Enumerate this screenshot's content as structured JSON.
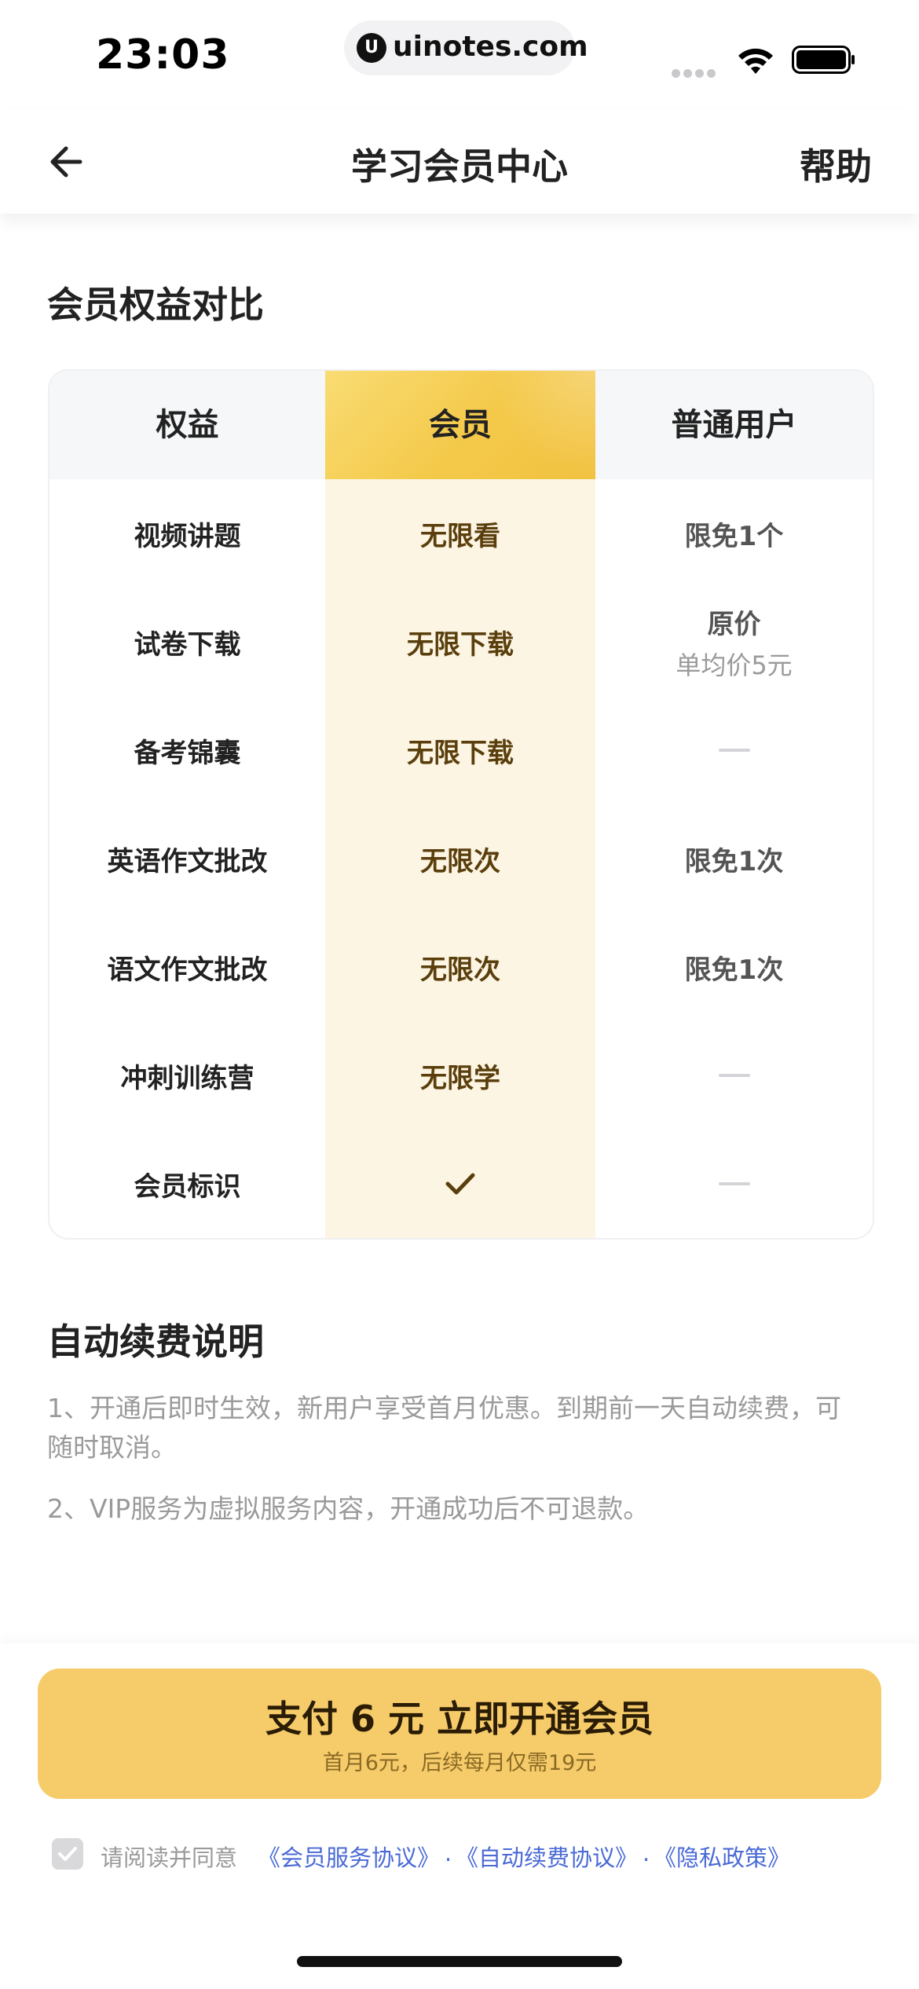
{
  "status_bar": {
    "time": "23:03",
    "url": "uinotes.com",
    "icons": [
      "signal-icon",
      "wifi-icon",
      "battery-icon"
    ]
  },
  "nav": {
    "title": "学习会员中心",
    "help": "帮助",
    "back_icon": "back-arrow-icon"
  },
  "benefits": {
    "title": "会员权益对比",
    "headers": [
      "权益",
      "会员",
      "普通用户"
    ],
    "rows": [
      {
        "benefit": "视频讲题",
        "member": "无限看",
        "normal": "限免1个",
        "normal_sub": ""
      },
      {
        "benefit": "试卷下载",
        "member": "无限下载",
        "normal": "原价",
        "normal_sub": "单均价5元"
      },
      {
        "benefit": "备考锦囊",
        "member": "无限下载",
        "normal": "",
        "normal_sub": ""
      },
      {
        "benefit": "英语作文批改",
        "member": "无限次",
        "normal": "限免1次",
        "normal_sub": ""
      },
      {
        "benefit": "语文作文批改",
        "member": "无限次",
        "normal": "限免1次",
        "normal_sub": ""
      },
      {
        "benefit": "冲刺训练营",
        "member": "无限学",
        "normal": "",
        "normal_sub": ""
      },
      {
        "benefit": "会员标识",
        "member": "",
        "normal": "",
        "normal_sub": ""
      }
    ]
  },
  "renewal": {
    "title": "自动续费说明",
    "notes": [
      "1、开通后即时生效，新用户享受首月优惠。到期前一天自动续费，可随时取消。",
      "2、VIP服务为虚拟服务内容，开通成功后不可退款。"
    ]
  },
  "pay": {
    "main": "支付 6 元  立即开通会员",
    "sub": "首月6元，后续每月仅需19元"
  },
  "agreement": {
    "prefix": "请阅读并同意",
    "links": [
      "《会员服务协议》",
      "《自动续费协议》",
      "《隐私政策》"
    ],
    "separator": "."
  },
  "colors": {
    "accent": "#f6cb6a",
    "member_column": "#fdf5e3",
    "link": "#4a6ad6"
  }
}
